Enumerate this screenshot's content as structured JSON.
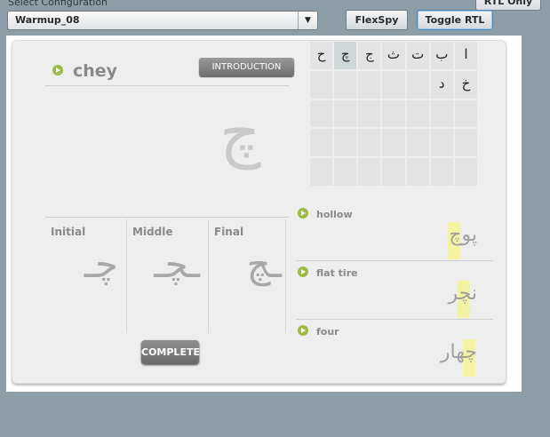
{
  "toolbar": {
    "config_label": "Select Configuration",
    "config_value": "Warmup_08",
    "flexspy_label": "FlexSpy",
    "toggle_rtl_label": "Toggle RTL",
    "rtl_only_label": "RTL Only"
  },
  "lesson": {
    "letter_name": "chey",
    "intro_label": "INTRODUCTION",
    "big_letter": "چ",
    "forms": [
      {
        "label": "Initial",
        "glyph": "چـ"
      },
      {
        "label": "Middle",
        "glyph": "ـچـ"
      },
      {
        "label": "Final",
        "glyph": "ـچ"
      }
    ],
    "complete_label": "COMPLETE"
  },
  "alphabet_grid": {
    "rows": [
      [
        "ح",
        "چ",
        "ج",
        "ث",
        "ت",
        "ب",
        "ا"
      ],
      [
        "",
        "",
        "",
        "",
        "",
        "د",
        "خ"
      ],
      [
        "",
        "",
        "",
        "",
        "",
        "",
        ""
      ],
      [
        "",
        "",
        "",
        "",
        "",
        "",
        ""
      ],
      [
        "",
        "",
        "",
        "",
        "",
        "",
        ""
      ]
    ]
  },
  "words": [
    {
      "meaning": "hollow",
      "word": "پوچ"
    },
    {
      "meaning": "flat tire",
      "word": "نچر"
    },
    {
      "meaning": "four",
      "word": "چهار"
    }
  ],
  "colors": {
    "background": "#8d9ea8",
    "accent_play": "#9dbb43",
    "highlight": "#f4f3a2"
  }
}
